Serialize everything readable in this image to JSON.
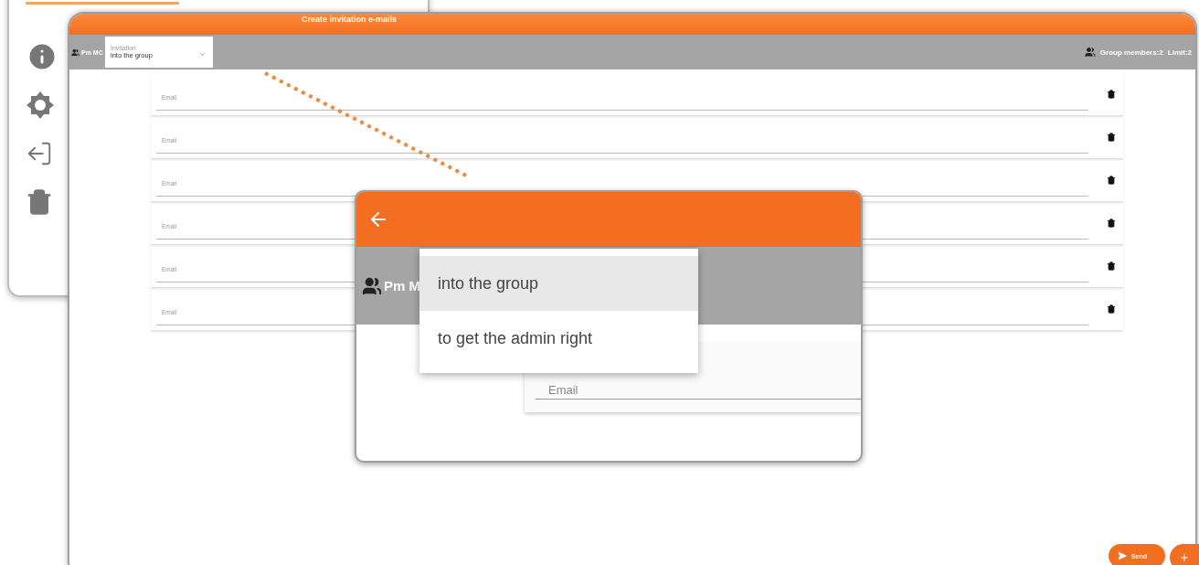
{
  "back_panel": {
    "items": [
      {
        "kind": "info"
      },
      {
        "kind": "settings"
      },
      {
        "kind": "logout"
      },
      {
        "kind": "delete"
      }
    ]
  },
  "window": {
    "title": "Create invitation e-mails"
  },
  "toolbar": {
    "group_name": "Pm MC",
    "invitation": {
      "label": "Invitation",
      "value": "into the group"
    },
    "members": "Group members:2",
    "limit": "Limit:2"
  },
  "email_rows": [
    {
      "placeholder": "Email"
    },
    {
      "placeholder": "Email"
    },
    {
      "placeholder": "Email"
    },
    {
      "placeholder": "Email"
    },
    {
      "placeholder": "Email"
    },
    {
      "placeholder": "Email"
    }
  ],
  "inset": {
    "group_name": "Pm M",
    "email_placeholder": "Email",
    "menu": [
      {
        "label": "into the group",
        "selected": true
      },
      {
        "label": "to get the admin right",
        "selected": false
      }
    ]
  },
  "actions": {
    "send": "Send"
  }
}
